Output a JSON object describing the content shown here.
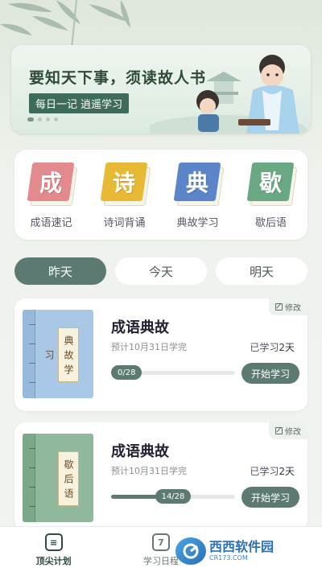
{
  "banner": {
    "title": "要知天下事，须读故人书",
    "tag": "每日一记 逍遥学习",
    "slides": 4,
    "active_slide": 1
  },
  "categories": [
    {
      "label": "成语速记",
      "glyph": "成",
      "color": "#e38a8e"
    },
    {
      "label": "诗词背诵",
      "glyph": "诗",
      "color": "#e8b934"
    },
    {
      "label": "典故学习",
      "glyph": "典",
      "color": "#5b85c8"
    },
    {
      "label": "歇后语",
      "glyph": "歇",
      "color": "#6aa883"
    }
  ],
  "day_tabs": [
    "昨天",
    "今天",
    "明天"
  ],
  "active_tab": 0,
  "courses": [
    {
      "edit_label": "修改",
      "title": "成语典故",
      "plan": "预计10月31日学完",
      "studied": "已学习",
      "studied_days": "2天",
      "progress_text": "0/28",
      "progress": 0.0,
      "button": "开始学习",
      "cover_text": "典故学习",
      "cover_color": "#a9c8e6"
    },
    {
      "edit_label": "修改",
      "title": "成语典故",
      "plan": "预计10月31日学完",
      "studied": "已学习",
      "studied_days": "2天",
      "progress_text": "14/28",
      "progress": 0.5,
      "button": "开始学习",
      "cover_text": "歇后语",
      "cover_color": "#8fb89c"
    }
  ],
  "nav": [
    {
      "label": "顶尖计划",
      "icon": "plan-icon",
      "glyph": "≡",
      "active": true
    },
    {
      "label": "学习日程",
      "icon": "calendar-icon",
      "glyph": "7",
      "active": false
    },
    {
      "label": "",
      "icon": "",
      "glyph": "",
      "active": false
    }
  ],
  "watermark": {
    "name": "西西软件园",
    "url": "CR173.COM"
  }
}
